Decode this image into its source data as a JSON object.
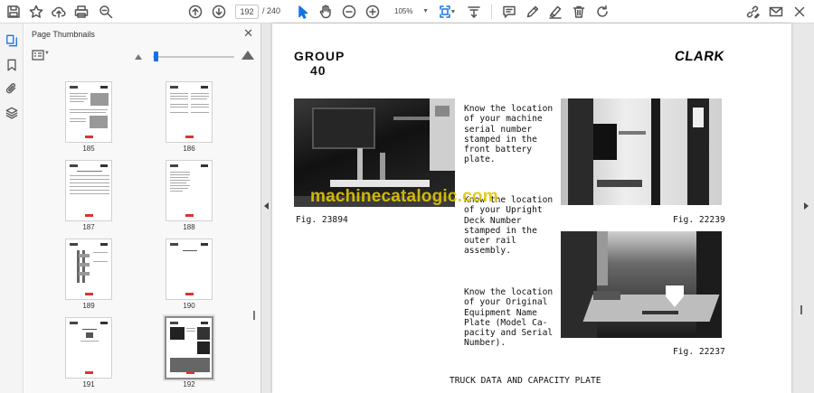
{
  "toolbar": {
    "current_page": "192",
    "total_pages": "/ 240",
    "zoom": "105%",
    "icons": [
      "save-icon",
      "star-icon",
      "cloud-upload-icon",
      "print-icon",
      "zoom-search-icon",
      "page-up-icon",
      "page-down-icon",
      "select-cursor-icon",
      "hand-icon",
      "zoom-out-icon",
      "zoom-in-icon",
      "fit-page-icon",
      "scroll-mode-icon",
      "comment-icon",
      "pen-icon",
      "highlighter-icon",
      "delete-icon",
      "rotate-icon",
      "link-edit-icon",
      "mail-icon",
      "close-icon"
    ]
  },
  "sidebar": {
    "title": "Page Thumbnails",
    "thumbnails": [
      {
        "page": "185"
      },
      {
        "page": "186"
      },
      {
        "page": "187"
      },
      {
        "page": "188"
      },
      {
        "page": "189"
      },
      {
        "page": "190"
      },
      {
        "page": "191"
      },
      {
        "page": "192",
        "selected": true
      }
    ]
  },
  "document": {
    "group_title": "GROUP",
    "group_number": "40",
    "brand": "CLARK",
    "paragraph_1": "Know the location\nof your machine\nserial number\nstamped in the\nfront battery\nplate.",
    "paragraph_2": "Know the location\nof your Upright\nDeck Number\nstamped in the\nouter rail\nassembly.",
    "paragraph_3": "Know the location\nof your Original\nEquipment Name\nPlate (Model Ca-\npacity and Serial\nNumber).",
    "fig_left": "Fig. 23894",
    "fig_right_top": "Fig. 22239",
    "fig_right_bottom": "Fig. 22237",
    "watermark": "machinecatalogic.com",
    "bottom_title": "TRUCK DATA AND CAPACITY PLATE"
  },
  "colors": {
    "accent": "#1473e6",
    "watermark": "#e1c800",
    "thumb_footer": "#dd3333"
  }
}
